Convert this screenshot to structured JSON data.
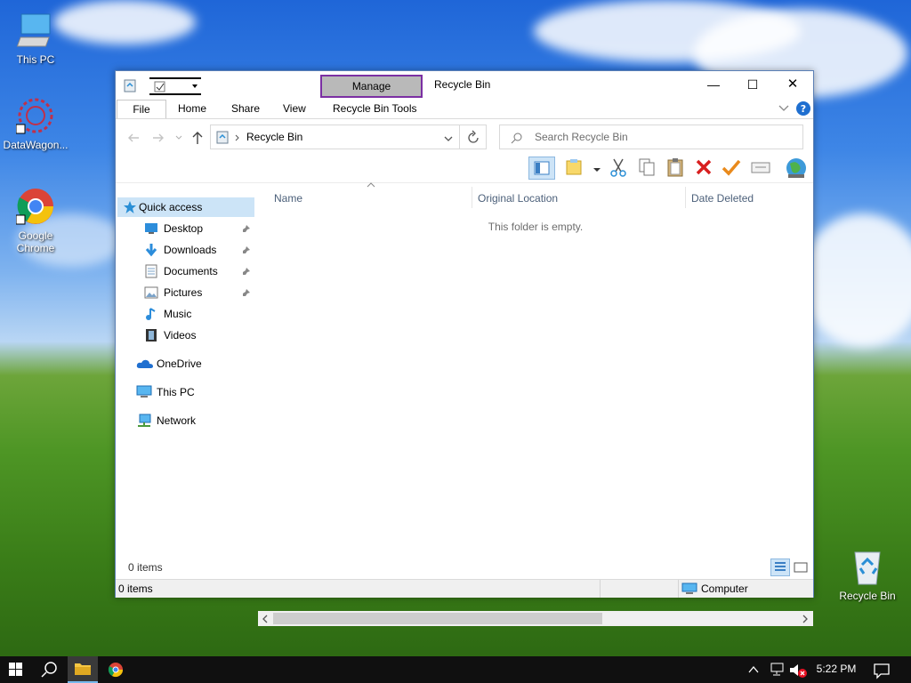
{
  "desktop": {
    "icons": [
      {
        "label": "This PC",
        "icon": "this-pc-icon"
      },
      {
        "label": "DataWagon...",
        "icon": "datawagon-icon"
      },
      {
        "label": "Google Chrome",
        "icon": "chrome-icon"
      },
      {
        "label": "Recycle Bin",
        "icon": "recycle-bin-icon"
      }
    ]
  },
  "window": {
    "title": "Recycle Bin",
    "context_tab": "Manage",
    "controls": {
      "minimize": "—",
      "maximize": "☐",
      "close": "✕"
    },
    "ribbon_tabs": [
      "File",
      "Home",
      "Share",
      "View",
      "Recycle Bin Tools"
    ],
    "address": "Recycle Bin",
    "search_placeholder": "Search Recycle Bin",
    "sidebar": {
      "quick_access": "Quick access",
      "items": [
        {
          "label": "Desktop",
          "pinned": true
        },
        {
          "label": "Downloads",
          "pinned": true
        },
        {
          "label": "Documents",
          "pinned": true
        },
        {
          "label": "Pictures",
          "pinned": true
        },
        {
          "label": "Music",
          "pinned": false
        },
        {
          "label": "Videos",
          "pinned": false
        }
      ],
      "onedrive": "OneDrive",
      "this_pc": "This PC",
      "network": "Network"
    },
    "columns": [
      "Name",
      "Original Location",
      "Date Deleted"
    ],
    "empty_message": "This folder is empty.",
    "item_count": "0 items",
    "status_items": "0 items",
    "status_location": "Computer"
  },
  "taskbar": {
    "time": "5:22 PM"
  },
  "colors": {
    "accent": "#0078d7",
    "manage_border": "#7b2fa3",
    "manage_fill": "#b9b9b9"
  }
}
